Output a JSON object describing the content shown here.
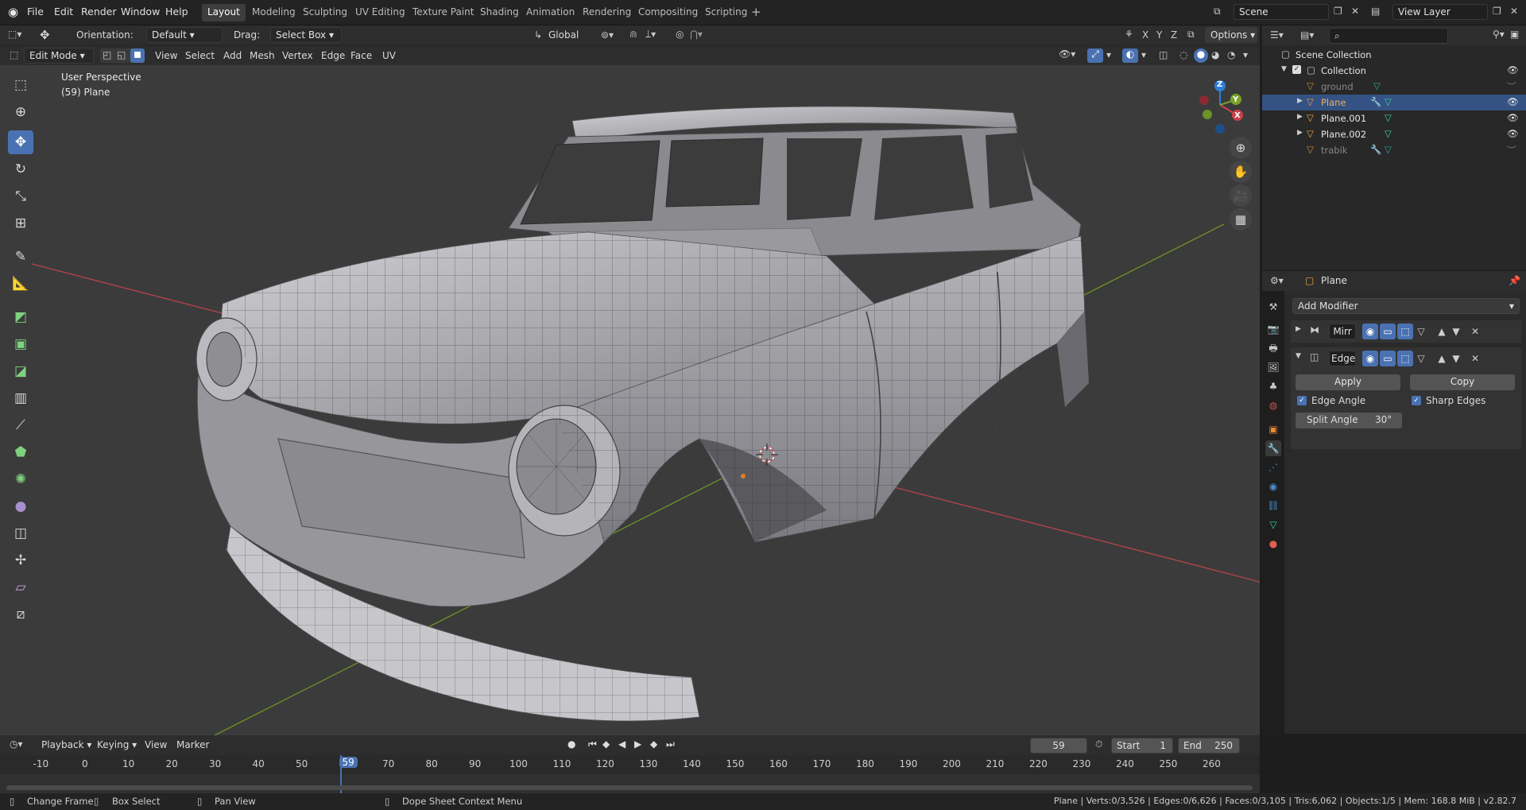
{
  "app": {
    "menu": [
      "File",
      "Edit",
      "Render",
      "Window",
      "Help"
    ],
    "workspaces": [
      "Layout",
      "Modeling",
      "Sculpting",
      "UV Editing",
      "Texture Paint",
      "Shading",
      "Animation",
      "Rendering",
      "Compositing",
      "Scripting"
    ],
    "active_workspace": "Layout",
    "scene": "Scene",
    "view_layer": "View Layer"
  },
  "viewport_header": {
    "orientation_label": "Orientation:",
    "orientation_value": "Default",
    "drag_label": "Drag:",
    "drag_value": "Select Box",
    "transform_orientation": "Global",
    "options": "Options",
    "mode": "Edit Mode",
    "menus": [
      "View",
      "Select",
      "Add",
      "Mesh",
      "Vertex",
      "Edge",
      "Face",
      "UV"
    ],
    "xyz": [
      "X",
      "Y",
      "Z"
    ]
  },
  "viewport": {
    "view_name": "User Perspective",
    "object_info": "(59) Plane",
    "gizmo": {
      "x": "X",
      "y": "Y",
      "z": "Z"
    }
  },
  "outliner": {
    "search_placeholder": "",
    "rows": [
      {
        "name": "Scene Collection"
      },
      {
        "name": "Collection"
      },
      {
        "name": "ground"
      },
      {
        "name": "Plane"
      },
      {
        "name": "Plane.001"
      },
      {
        "name": "Plane.002"
      },
      {
        "name": "trabik"
      }
    ]
  },
  "properties": {
    "object_name": "Plane",
    "add_modifier": "Add Modifier",
    "modifiers": [
      {
        "name": "Mirr"
      },
      {
        "name": "Edge"
      }
    ],
    "apply": "Apply",
    "copy": "Copy",
    "edge_angle": "Edge Angle",
    "sharp_edges": "Sharp Edges",
    "split_angle_label": "Split Angle",
    "split_angle_value": "30°"
  },
  "timeline": {
    "menus": [
      "Playback",
      "Keying",
      "View",
      "Marker"
    ],
    "current_frame": "59",
    "start_label": "Start",
    "start_value": "1",
    "end_label": "End",
    "end_value": "250",
    "ticks": [
      "-10",
      "0",
      "10",
      "20",
      "30",
      "40",
      "50",
      "59",
      "70",
      "80",
      "90",
      "100",
      "110",
      "120",
      "130",
      "140",
      "150",
      "160",
      "170",
      "180",
      "190",
      "200",
      "210",
      "220",
      "230",
      "240",
      "250",
      "260"
    ]
  },
  "statusbar": {
    "change_frame": "Change Frame",
    "box_select": "Box Select",
    "pan_view": "Pan View",
    "context_menu": "Dope Sheet Context Menu",
    "stats": "Plane | Verts:0/3,526 | Edges:0/6,626 | Faces:0/3,105 | Tris:6,062 | Objects:1/5 | Mem: 168.8 MiB | v2.82.7"
  },
  "colors": {
    "accent": "#4a72b2",
    "selected_row": "#345284",
    "axis_x": "#c8404a",
    "axis_y": "#7aa02a",
    "axis_z": "#2e7fd8"
  }
}
